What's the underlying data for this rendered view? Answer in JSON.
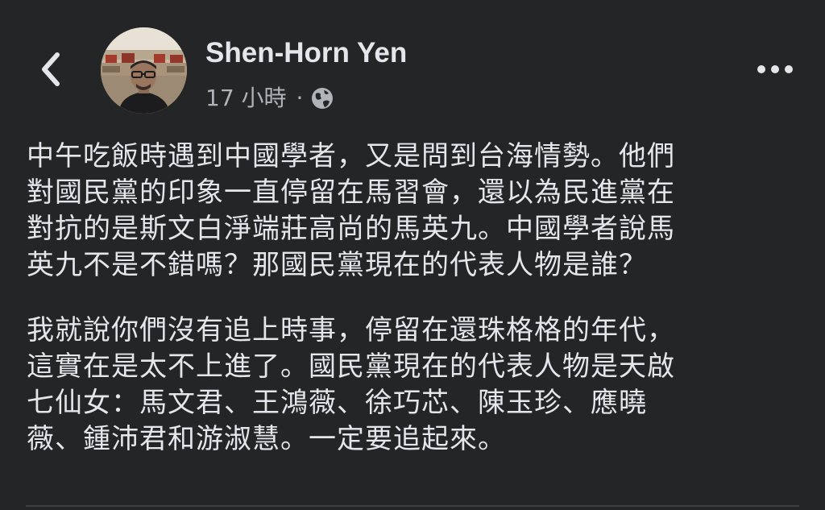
{
  "header": {
    "back_icon": "chevron-left-icon",
    "author_name": "Shen-Horn Yen",
    "timestamp": "17 小時",
    "separator": "·",
    "privacy_icon": "globe-icon",
    "more_icon": "more-horizontal-icon"
  },
  "post": {
    "paragraphs": [
      {
        "lines": [
          "中午吃飯時遇到中國學者，又是問到台海情勢。他們",
          "對國民黨的印象一直停留在馬習會，還以為民進黨在",
          "對抗的是斯文白淨端莊高尚的馬英九。中國學者說馬",
          "英九不是不錯嗎？那國民黨現在的代表人物是誰？"
        ]
      },
      {
        "lines": [
          "我就說你們沒有追上時事，停留在還珠格格的年代，",
          "這實在是太不上進了。國民黨現在的代表人物是天啟",
          "七仙女：馬文君、王鴻薇、徐巧芯、陳玉珍、應曉",
          "薇、鍾沛君和游淑慧。一定要追起來。"
        ]
      }
    ]
  },
  "colors": {
    "background": "#242526",
    "primary_text": "#e4e6eb",
    "secondary_text": "#b0b3b8",
    "divider": "#3e4042"
  }
}
